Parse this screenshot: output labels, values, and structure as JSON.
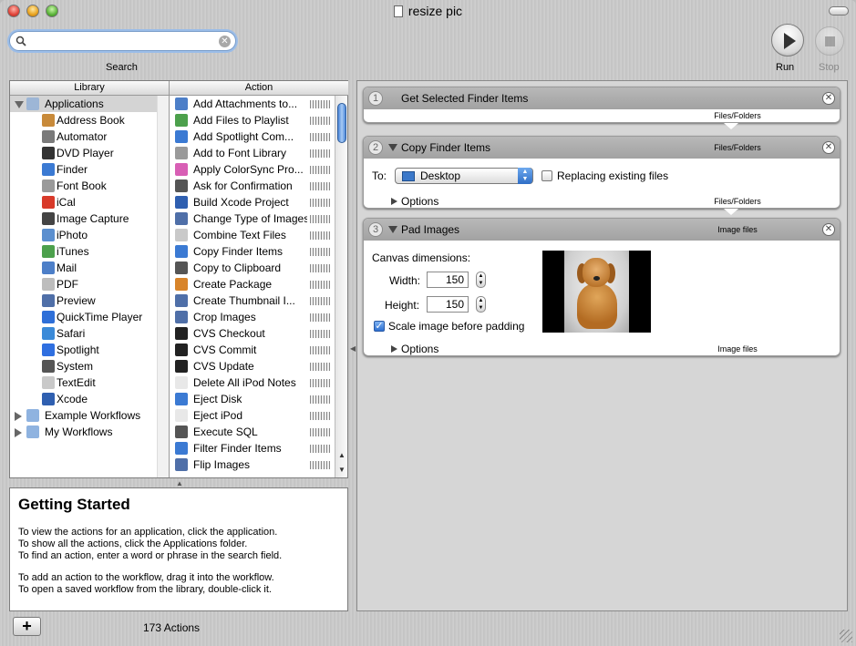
{
  "window": {
    "title": "resize pic"
  },
  "search": {
    "value": "",
    "label": "Search"
  },
  "toolbar": {
    "run_label": "Run",
    "stop_label": "Stop"
  },
  "library": {
    "header": "Library",
    "items": [
      {
        "label": "Applications",
        "kind": "group-open",
        "icon": "applications-folder-icon",
        "color": "#9db6d6"
      },
      {
        "label": "Address Book",
        "kind": "child",
        "icon": "address-book-icon",
        "color": "#c88a3a"
      },
      {
        "label": "Automator",
        "kind": "child",
        "icon": "automator-icon",
        "color": "#7a7a7a"
      },
      {
        "label": "DVD Player",
        "kind": "child",
        "icon": "dvd-player-icon",
        "color": "#333333"
      },
      {
        "label": "Finder",
        "kind": "child",
        "icon": "finder-icon",
        "color": "#3b7ad3"
      },
      {
        "label": "Font Book",
        "kind": "child",
        "icon": "font-book-icon",
        "color": "#9a9a9a"
      },
      {
        "label": "iCal",
        "kind": "child",
        "icon": "ical-icon",
        "color": "#d83a2a"
      },
      {
        "label": "Image Capture",
        "kind": "child",
        "icon": "image-capture-icon",
        "color": "#444444"
      },
      {
        "label": "iPhoto",
        "kind": "child",
        "icon": "iphoto-icon",
        "color": "#5b8fcf"
      },
      {
        "label": "iTunes",
        "kind": "child",
        "icon": "itunes-icon",
        "color": "#4ca04c"
      },
      {
        "label": "Mail",
        "kind": "child",
        "icon": "mail-icon",
        "color": "#4d7fc8"
      },
      {
        "label": "PDF",
        "kind": "child",
        "icon": "pdf-icon",
        "color": "#bdbdbd"
      },
      {
        "label": "Preview",
        "kind": "child",
        "icon": "preview-icon",
        "color": "#4f6fa8"
      },
      {
        "label": "QuickTime Player",
        "kind": "child",
        "icon": "quicktime-icon",
        "color": "#2e6fd8"
      },
      {
        "label": "Safari",
        "kind": "child",
        "icon": "safari-icon",
        "color": "#3b8ad8"
      },
      {
        "label": "Spotlight",
        "kind": "child",
        "icon": "spotlight-icon",
        "color": "#2f6fe0"
      },
      {
        "label": "System",
        "kind": "child",
        "icon": "system-icon",
        "color": "#555555"
      },
      {
        "label": "TextEdit",
        "kind": "child",
        "icon": "textedit-icon",
        "color": "#c9c9c9"
      },
      {
        "label": "Xcode",
        "kind": "child",
        "icon": "xcode-icon",
        "color": "#2f5fb0"
      },
      {
        "label": "Example Workflows",
        "kind": "group-closed",
        "icon": "folder-icon",
        "color": "#8fb3e0"
      },
      {
        "label": "My Workflows",
        "kind": "group-closed",
        "icon": "folder-icon",
        "color": "#8fb3e0"
      }
    ]
  },
  "actions": {
    "header": "Action",
    "items": [
      {
        "label": "Add Attachments to...",
        "icon": "mail-icon",
        "color": "#4d7fc8"
      },
      {
        "label": "Add Files to Playlist",
        "icon": "itunes-icon",
        "color": "#4ca04c"
      },
      {
        "label": "Add Spotlight Com...",
        "icon": "finder-icon",
        "color": "#3b7ad3"
      },
      {
        "label": "Add to Font Library",
        "icon": "font-book-icon",
        "color": "#9a9a9a"
      },
      {
        "label": "Apply ColorSync Pro...",
        "icon": "colorsync-icon",
        "color": "#d85fb5"
      },
      {
        "label": "Ask for Confirmation",
        "icon": "system-icon",
        "color": "#555555"
      },
      {
        "label": "Build Xcode Project",
        "icon": "xcode-icon",
        "color": "#2f5fb0"
      },
      {
        "label": "Change Type of Images",
        "icon": "preview-icon",
        "color": "#4f6fa8"
      },
      {
        "label": "Combine Text Files",
        "icon": "textedit-icon",
        "color": "#c9c9c9"
      },
      {
        "label": "Copy Finder Items",
        "icon": "finder-icon",
        "color": "#3b7ad3"
      },
      {
        "label": "Copy to Clipboard",
        "icon": "system-icon",
        "color": "#555555"
      },
      {
        "label": "Create Package",
        "icon": "package-icon",
        "color": "#d8842a"
      },
      {
        "label": "Create Thumbnail I...",
        "icon": "preview-icon",
        "color": "#4f6fa8"
      },
      {
        "label": "Crop Images",
        "icon": "preview-icon",
        "color": "#4f6fa8"
      },
      {
        "label": "CVS Checkout",
        "icon": "terminal-icon",
        "color": "#222222"
      },
      {
        "label": "CVS Commit",
        "icon": "terminal-icon",
        "color": "#222222"
      },
      {
        "label": "CVS Update",
        "icon": "terminal-icon",
        "color": "#222222"
      },
      {
        "label": "Delete All iPod Notes",
        "icon": "ipod-icon",
        "color": "#e8e8e8"
      },
      {
        "label": "Eject Disk",
        "icon": "finder-icon",
        "color": "#3b7ad3"
      },
      {
        "label": "Eject iPod",
        "icon": "ipod-icon",
        "color": "#e8e8e8"
      },
      {
        "label": "Execute SQL",
        "icon": "system-icon",
        "color": "#555555"
      },
      {
        "label": "Filter Finder Items",
        "icon": "finder-icon",
        "color": "#3b7ad3"
      },
      {
        "label": "Flip Images",
        "icon": "preview-icon",
        "color": "#4f6fa8"
      }
    ]
  },
  "description": {
    "title": "Getting Started",
    "lines_a": [
      "To view the actions for an application, click the application.",
      "To show all the actions, click the Applications folder.",
      "To find an action, enter a word or phrase in the search field."
    ],
    "lines_b": [
      "To add an action to the workflow, drag it into the workflow.",
      "To open a saved workflow from the library, double-click it."
    ]
  },
  "footer": {
    "add_label": "+",
    "count": "173 Actions"
  },
  "workflow": {
    "step1": {
      "num": "1",
      "title": "Get Selected Finder Items",
      "output": "Files/Folders"
    },
    "step2": {
      "num": "2",
      "title": "Copy Finder Items",
      "input": "Files/Folders",
      "to_label": "To:",
      "destination": "Desktop",
      "replace_label": "Replacing existing files",
      "replace_checked": false,
      "options_label": "Options",
      "output": "Files/Folders"
    },
    "step3": {
      "num": "3",
      "title": "Pad Images",
      "input": "Image files",
      "canvas_label": "Canvas dimensions:",
      "width_label": "Width:",
      "width_value": "150",
      "height_label": "Height:",
      "height_value": "150",
      "scale_label": "Scale image before padding",
      "scale_checked": true,
      "options_label": "Options",
      "output": "Image files"
    }
  }
}
